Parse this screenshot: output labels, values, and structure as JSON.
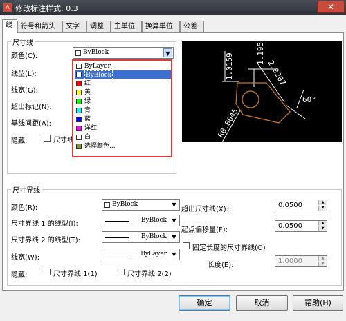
{
  "window": {
    "title": "修改标注样式: 0.3",
    "close_glyph": "✕"
  },
  "tabs": [
    "线",
    "符号和箭头",
    "文字",
    "调整",
    "主单位",
    "换算单位",
    "公差"
  ],
  "dimension_lines": {
    "group_label": "尺寸线",
    "color_label": "颜色(C):",
    "color_value": "ByBlock",
    "linetype_label": "线型(L):",
    "lineweight_label": "线宽(G):",
    "extend_label": "超出标记(N):",
    "baseline_label": "基线间距(A):",
    "suppress_label": "隐藏:",
    "suppress_cb1_label": "尺寸线"
  },
  "dropdown": {
    "items": [
      {
        "label": "ByLayer",
        "color": "#ffffff"
      },
      {
        "label": "ByBlock",
        "color": "#ffffff"
      },
      {
        "label": "红",
        "color": "#ff0000"
      },
      {
        "label": "黄",
        "color": "#ffff00"
      },
      {
        "label": "绿",
        "color": "#00ff00"
      },
      {
        "label": "青",
        "color": "#00ffff"
      },
      {
        "label": "蓝",
        "color": "#0000ff"
      },
      {
        "label": "洋红",
        "color": "#ff00ff"
      },
      {
        "label": "白",
        "color": "#ffffff"
      },
      {
        "label": "选择颜色...",
        "color": "#7a9a3a"
      }
    ],
    "selected": "ByBlock"
  },
  "preview": {
    "dims": [
      "1.0159",
      "1.1955",
      "2.0207",
      "60°",
      "R0.8045"
    ]
  },
  "extension_lines": {
    "group_label": "尺寸界线",
    "color_label": "颜色(R):",
    "color_value": "ByBlock",
    "ext1_linetype_label": "尺寸界线 1 的线型(I):",
    "ext1_linetype_value": "ByBlock",
    "ext2_linetype_label": "尺寸界线 2 的线型(T):",
    "ext2_linetype_value": "ByBlock",
    "lineweight_label": "线宽(W):",
    "lineweight_value": "ByLayer",
    "suppress_label": "隐藏:",
    "suppress_ext1_label": "尺寸界线 1(1)",
    "suppress_ext2_label": "尺寸界线 2(2)",
    "extend_label": "超出尺寸线(X):",
    "extend_value": "0.0500",
    "offset_label": "起点偏移量(F):",
    "offset_value": "0.0500",
    "fixed_length_label": "固定长度的尺寸界线(O)",
    "length_label": "长度(E):",
    "length_value": "1.0000"
  },
  "buttons": {
    "ok": "确定",
    "cancel": "取消",
    "help": "帮助(H)"
  }
}
